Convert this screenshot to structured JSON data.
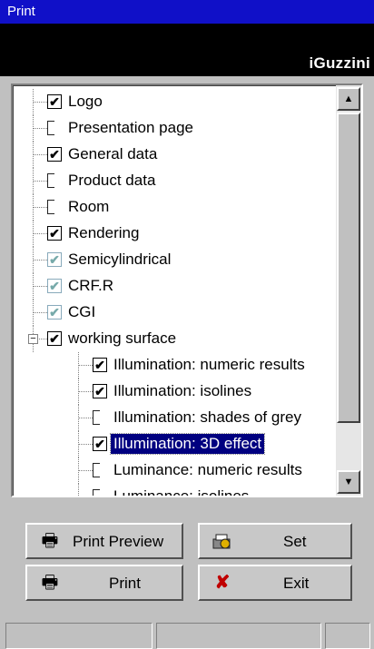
{
  "window": {
    "title": "Print",
    "brand": "iGuzzini"
  },
  "tree": {
    "items": [
      {
        "label": "Logo",
        "state": "checked",
        "level": 0
      },
      {
        "label": "Presentation page",
        "state": "unchecked",
        "level": 0
      },
      {
        "label": "General data",
        "state": "checked",
        "level": 0
      },
      {
        "label": "Product data",
        "state": "unchecked",
        "level": 0
      },
      {
        "label": "Room",
        "state": "unchecked",
        "level": 0
      },
      {
        "label": "Rendering",
        "state": "checked",
        "level": 0
      },
      {
        "label": "Semicylindrical",
        "state": "greyed",
        "level": 0
      },
      {
        "label": "CRF.R",
        "state": "greyed",
        "level": 0
      },
      {
        "label": "CGI",
        "state": "greyed",
        "level": 0
      },
      {
        "label": "working surface",
        "state": "checked",
        "level": 0,
        "expanded": true
      },
      {
        "label": "Illumination: numeric results",
        "state": "checked",
        "level": 1
      },
      {
        "label": "Illumination: isolines",
        "state": "checked",
        "level": 1
      },
      {
        "label": "Illumination: shades of grey",
        "state": "unchecked",
        "level": 1
      },
      {
        "label": "Illumination: 3D effect",
        "state": "checked",
        "level": 1,
        "selected": true
      },
      {
        "label": "Luminance: numeric results",
        "state": "unchecked",
        "level": 1
      },
      {
        "label": "Luminance: isolines",
        "state": "unchecked",
        "level": 1
      }
    ]
  },
  "buttons": {
    "print_preview": "Print Preview",
    "set": "Set",
    "print": "Print",
    "exit": "Exit"
  },
  "icons": {
    "check": "✔",
    "scroll_up": "▲",
    "scroll_down": "▼",
    "expander_minus": "−",
    "printer": "🖶",
    "exit_x": "✘",
    "set": "printer-key-icon"
  },
  "colors": {
    "title_bg": "#1010c8",
    "selection": "#000080",
    "exit_red": "#c00000"
  }
}
